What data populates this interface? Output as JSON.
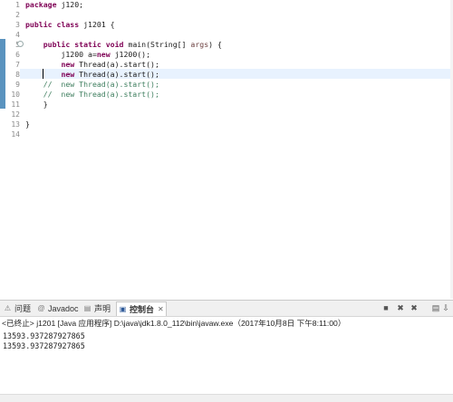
{
  "editor": {
    "line_numbers": [
      "1",
      "2",
      "3",
      "4",
      "5",
      "6",
      "7",
      "8",
      "9",
      "10",
      "11",
      "12",
      "13",
      "14"
    ],
    "fold_marker_line": "5",
    "lines": [
      [
        {
          "t": "kw",
          "v": "package"
        },
        {
          "t": "n",
          "v": " j120;"
        }
      ],
      [],
      [
        {
          "t": "kw",
          "v": "public"
        },
        {
          "t": "n",
          "v": " "
        },
        {
          "t": "kw",
          "v": "class"
        },
        {
          "t": "n",
          "v": " j1201 {"
        }
      ],
      [],
      [
        {
          "t": "n",
          "v": "    "
        },
        {
          "t": "kw",
          "v": "public"
        },
        {
          "t": "n",
          "v": " "
        },
        {
          "t": "kw",
          "v": "static"
        },
        {
          "t": "n",
          "v": " "
        },
        {
          "t": "kw",
          "v": "void"
        },
        {
          "t": "n",
          "v": " main(String[] "
        },
        {
          "t": "arg",
          "v": "args"
        },
        {
          "t": "n",
          "v": ") {"
        }
      ],
      [
        {
          "t": "n",
          "v": "        j1200 a="
        },
        {
          "t": "kw",
          "v": "new"
        },
        {
          "t": "n",
          "v": " j1200();"
        }
      ],
      [
        {
          "t": "n",
          "v": "        "
        },
        {
          "t": "kw",
          "v": "new"
        },
        {
          "t": "n",
          "v": " Thread(a).start();"
        }
      ],
      [
        {
          "t": "n",
          "v": "        "
        },
        {
          "t": "kw",
          "v": "new"
        },
        {
          "t": "n",
          "v": " Thread(a).start();"
        }
      ],
      [
        {
          "t": "cm",
          "v": "    //  new Thread(a).start();"
        }
      ],
      [
        {
          "t": "cm",
          "v": "    //  new Thread(a).start();"
        }
      ],
      [
        {
          "t": "n",
          "v": "    }"
        }
      ],
      [],
      [
        {
          "t": "n",
          "v": "}"
        }
      ],
      []
    ]
  },
  "console": {
    "tabs": [
      {
        "icon": "problems-icon",
        "glyph": "⚠",
        "label": "问题",
        "active": false
      },
      {
        "icon": "javadoc-icon",
        "glyph": "@",
        "label": "Javadoc",
        "active": false
      },
      {
        "icon": "declaration-icon",
        "glyph": "▤",
        "label": "声明",
        "active": false
      },
      {
        "icon": "console-icon",
        "glyph": "▣",
        "label": "控制台",
        "active": true
      }
    ],
    "close_glyph": "✕",
    "toolbar": [
      {
        "name": "terminate-button",
        "glyph": "■"
      },
      {
        "name": "remove-launch-button",
        "glyph": "✖"
      },
      {
        "name": "remove-all-terminated-button",
        "glyph": "✖"
      },
      {
        "name": "clear-console-button",
        "glyph": "▤"
      },
      {
        "name": "scroll-lock-button",
        "glyph": "⇩"
      },
      {
        "name": "pin-console-button",
        "glyph": "⇧"
      }
    ],
    "header": "<已终止> j1201 [Java 应用程序] D:\\java\\jdk1.8.0_112\\bin\\javaw.exe（2017年10月8日 下午8:11:00）",
    "output": [
      "13593.937287927865",
      "13593.937287927865"
    ]
  }
}
